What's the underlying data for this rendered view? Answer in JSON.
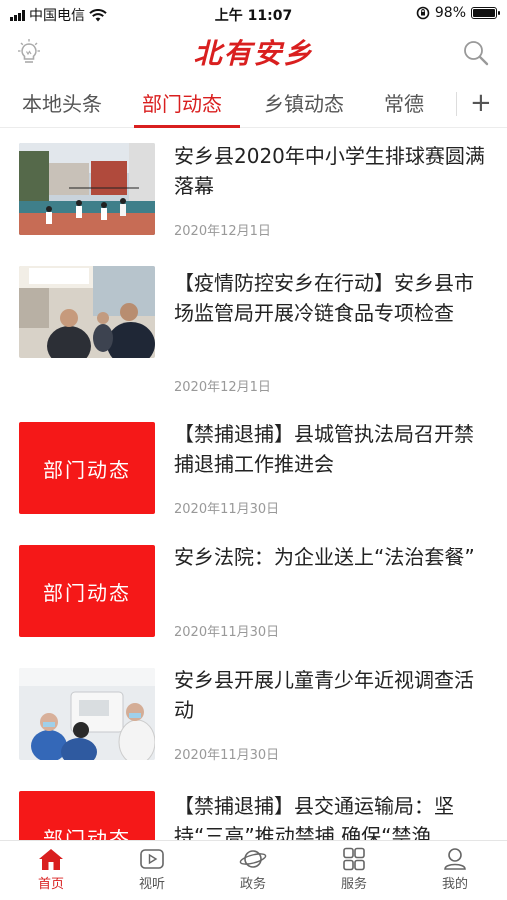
{
  "status_bar": {
    "carrier": "中国电信",
    "time": "上午 11:07",
    "battery": "98%",
    "battery_level": 0.98
  },
  "header": {
    "logo": "北有安乡",
    "left_icon": "lightbulb-icon",
    "right_icon": "search-icon"
  },
  "tabs": {
    "items": [
      {
        "label": "本地头条",
        "active": false
      },
      {
        "label": "部门动态",
        "active": true
      },
      {
        "label": "乡镇动态",
        "active": false
      },
      {
        "label": "常德",
        "active": false
      }
    ],
    "add_label": "+"
  },
  "news": [
    {
      "title": "安乡县2020年中小学生排球赛圆满落幕",
      "date": "2020年12月1日",
      "thumb": "photo-volleyball"
    },
    {
      "title": "【疫情防控安乡在行动】安乡县市场监管局开展冷链食品专项检查",
      "date": "2020年12月1日",
      "thumb": "photo-inspection"
    },
    {
      "title": "【禁捕退捕】县城管执法局召开禁捕退捕工作推进会",
      "date": "2020年11月30日",
      "thumb_text": "部门动态"
    },
    {
      "title": "安乡法院：为企业送上“法治套餐”",
      "date": "2020年11月30日",
      "thumb_text": "部门动态"
    },
    {
      "title": "安乡县开展儿童青少年近视调查活动",
      "date": "2020年11月30日",
      "thumb": "photo-eye-exam"
    },
    {
      "title": "【禁捕退捕】县交通运输局：坚持“三高”推动禁捕 确保“禁渔",
      "date": "",
      "thumb_text": "部门动态"
    }
  ],
  "bottom_nav": [
    {
      "label": "首页",
      "icon": "home-icon",
      "active": true
    },
    {
      "label": "视听",
      "icon": "play-icon",
      "active": false
    },
    {
      "label": "政务",
      "icon": "planet-icon",
      "active": false
    },
    {
      "label": "服务",
      "icon": "grid-icon",
      "active": false
    },
    {
      "label": "我的",
      "icon": "user-icon",
      "active": false
    }
  ],
  "colors": {
    "brand_red": "#d91f1f",
    "thumb_red": "#f51818"
  }
}
